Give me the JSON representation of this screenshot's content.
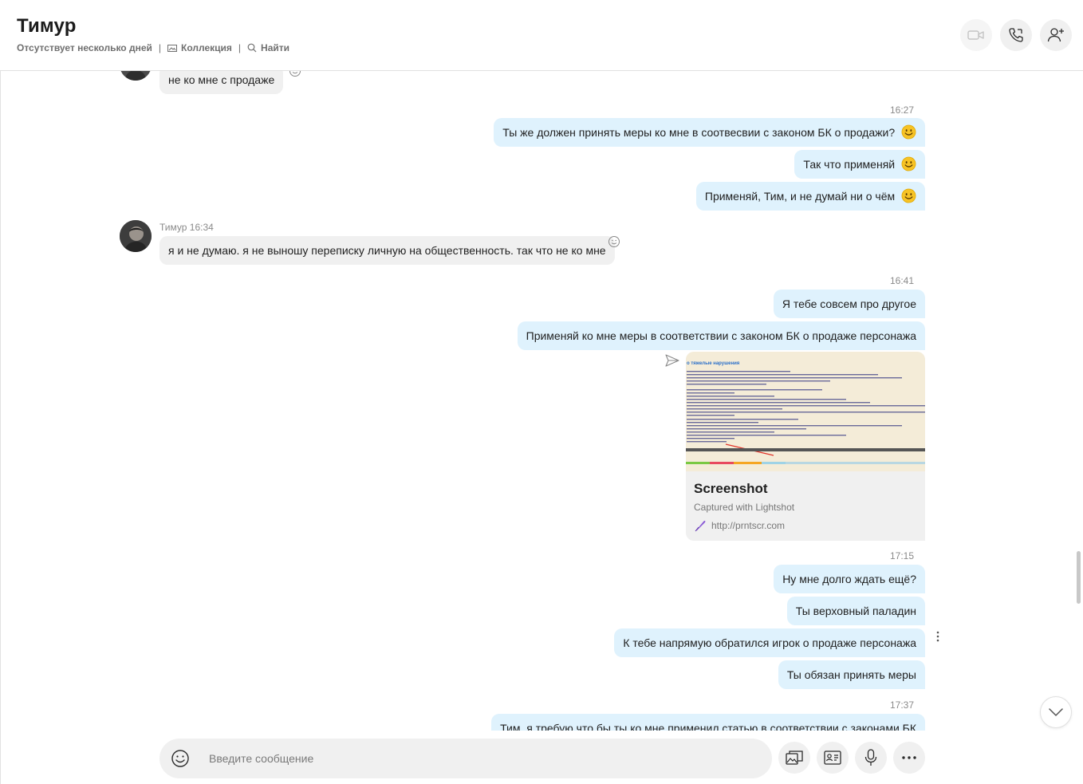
{
  "header": {
    "title": "Тимур",
    "status": "Отсутствует несколько дней",
    "separator": "|",
    "gallery_label": "Коллекция",
    "find_label": "Найти"
  },
  "messages": {
    "partial_incoming": "не ко мне с продаже",
    "ts_1": "16:27",
    "out_1": "Ты же должен принять меры ко мне в соотвесвии с законом БК о продажи?",
    "out_2": "Так что  применяй",
    "out_3": "Применяй, Тим, и не думай ни о чём",
    "sender_info": "Тимур 16:34",
    "in_1": "я и не думаю. я не выношу переписку личную на общественность. так что не ко мне",
    "ts_2": "16:41",
    "out_4": "Я тебе совсем про другое",
    "out_5": "Применяй ко мне меры в соответствии   с законом БК о продаже персонажа",
    "ts_3": "17:15",
    "out_6": "Ну мне долго ждать ещё?",
    "out_7": "Ты верховный паладин",
    "out_8": "К тебе напрямую обратился игрок о продаже персонажа",
    "out_9": "Ты обязан принять меры",
    "ts_4": "17:37",
    "out_10": "Тим, я требую что бы ты ко мне применил статью в соответствии с законами БК"
  },
  "link_preview": {
    "title": "Screenshot",
    "description": "Captured with Lightshot",
    "url": "http://prntscr.com",
    "thumb_heading": "о тяжелые нарушения"
  },
  "composer": {
    "placeholder": "Введите сообщение"
  },
  "colors": {
    "outgoing_bubble": "#dff2fd",
    "incoming_bubble": "#f0f0f0",
    "emoji_yellow": "#f7c325"
  }
}
